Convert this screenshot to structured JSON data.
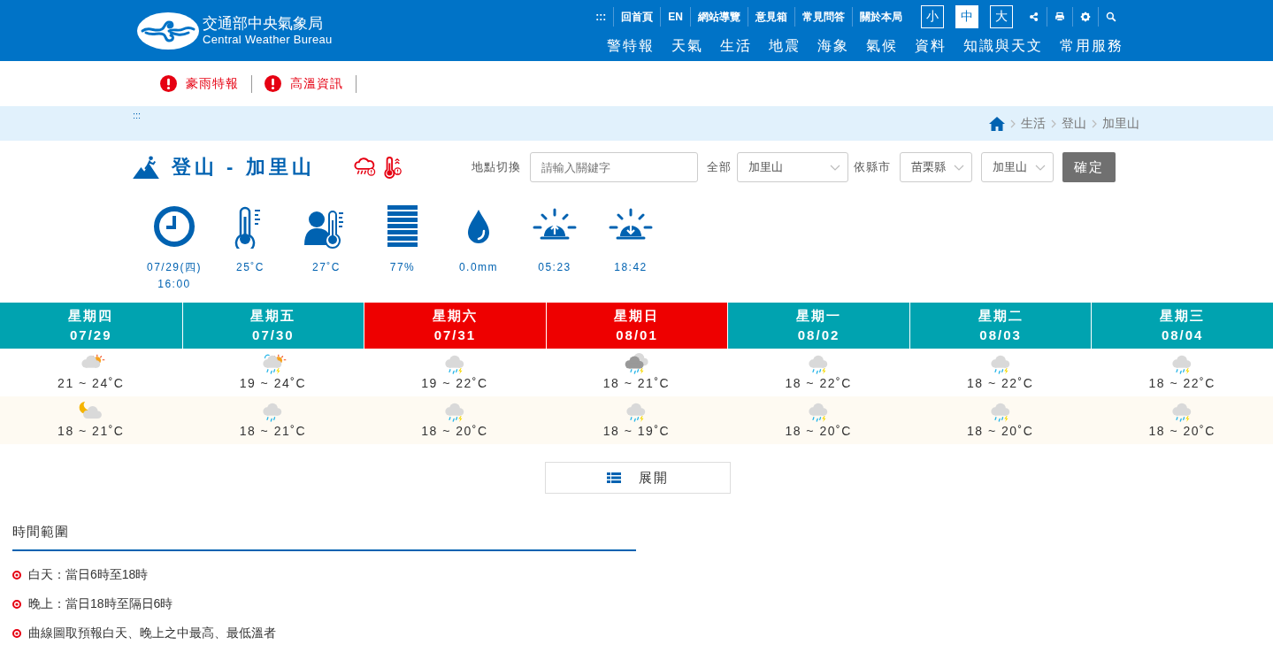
{
  "header": {
    "logo_title": "交通部中央氣象局",
    "logo_subtitle": "Central Weather Bureau",
    "util_links": [
      ":::",
      "回首頁",
      "EN",
      "網站導覽",
      "意見箱",
      "常見問答",
      "關於本局"
    ],
    "font_sizes": [
      {
        "label": "小",
        "selected": false
      },
      {
        "label": "中",
        "selected": true
      },
      {
        "label": "大",
        "selected": false
      }
    ],
    "nav": [
      "警特報",
      "天氣",
      "生活",
      "地震",
      "海象",
      "氣候",
      "資料",
      "知識與天文",
      "常用服務"
    ]
  },
  "alerts": [
    "豪雨特報",
    "高溫資訊"
  ],
  "breadcrumb": {
    "marker": ":::",
    "items": [
      "生活",
      "登山",
      "加里山"
    ]
  },
  "title": "登山 - 加里山",
  "search": {
    "label": "地點切換",
    "placeholder": "請輸入關鍵字",
    "all_label": "全部",
    "all_value": "加里山",
    "county_label": "依縣市",
    "county_value": "苗栗縣",
    "site_value": "加里山",
    "submit": "確定"
  },
  "current": [
    {
      "kind": "clock",
      "lines": [
        "07/29(四)",
        "16:00"
      ]
    },
    {
      "kind": "thermometer",
      "lines": [
        "25˚C"
      ]
    },
    {
      "kind": "feels-like",
      "lines": [
        "27˚C"
      ]
    },
    {
      "kind": "humidity",
      "lines": [
        "77%"
      ]
    },
    {
      "kind": "rain",
      "lines": [
        "0.0mm"
      ]
    },
    {
      "kind": "sunrise",
      "lines": [
        "05:23"
      ]
    },
    {
      "kind": "sunset",
      "lines": [
        "18:42"
      ]
    }
  ],
  "forecast": {
    "days": [
      {
        "weekday": "星期四",
        "date": "07/29",
        "color": "#00a3b0"
      },
      {
        "weekday": "星期五",
        "date": "07/30",
        "color": "#00a3b0"
      },
      {
        "weekday": "星期六",
        "date": "07/31",
        "color": "#ee0000"
      },
      {
        "weekday": "星期日",
        "date": "08/01",
        "color": "#ee0000"
      },
      {
        "weekday": "星期一",
        "date": "08/02",
        "color": "#00a3b0"
      },
      {
        "weekday": "星期二",
        "date": "08/03",
        "color": "#00a3b0"
      },
      {
        "weekday": "星期三",
        "date": "08/04",
        "color": "#00a3b0"
      }
    ],
    "rows": [
      {
        "kind": "day",
        "cells": [
          {
            "kind": "sun-cloud",
            "temp": "21 ~ 24˚C"
          },
          {
            "kind": "sun-thunder-rain",
            "temp": "19 ~ 24˚C"
          },
          {
            "kind": "thunder-rain",
            "temp": "19 ~ 22˚C"
          },
          {
            "kind": "dark-thunder-rain",
            "temp": "18 ~ 21˚C"
          },
          {
            "kind": "thunder-rain",
            "temp": "18 ~ 22˚C"
          },
          {
            "kind": "thunder-rain",
            "temp": "18 ~ 22˚C"
          },
          {
            "kind": "thunder-rain",
            "temp": "18 ~ 22˚C"
          }
        ]
      },
      {
        "kind": "night",
        "cells": [
          {
            "kind": "moon-cloud",
            "temp": "18 ~ 21˚C"
          },
          {
            "kind": "rain",
            "temp": "18 ~ 21˚C"
          },
          {
            "kind": "thunder-rain",
            "temp": "18 ~ 20˚C"
          },
          {
            "kind": "thunder-rain",
            "temp": "18 ~ 19˚C"
          },
          {
            "kind": "thunder-rain",
            "temp": "18 ~ 20˚C"
          },
          {
            "kind": "thunder-rain",
            "temp": "18 ~ 20˚C"
          },
          {
            "kind": "thunder-rain",
            "temp": "18 ~ 20˚C"
          }
        ]
      }
    ]
  },
  "expand_button": "展開",
  "notes": {
    "title": "時間範圍",
    "items": [
      "白天：當日6時至18時",
      "晚上：當日18時至隔日6時",
      "曲線圖取預報白天、晚上之中最高、最低溫者"
    ]
  }
}
